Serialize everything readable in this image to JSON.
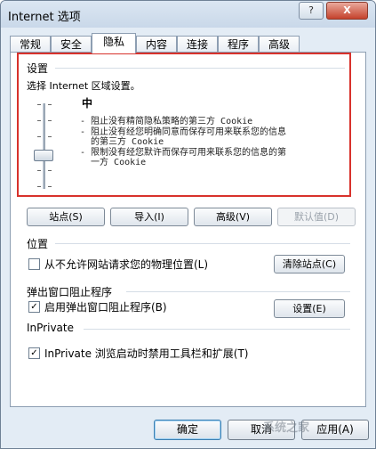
{
  "window": {
    "title": "Internet 选项",
    "help_label": "?",
    "close_label": "X"
  },
  "tabs": [
    {
      "label": "常规"
    },
    {
      "label": "安全"
    },
    {
      "label": "隐私"
    },
    {
      "label": "内容"
    },
    {
      "label": "连接"
    },
    {
      "label": "程序"
    },
    {
      "label": "高级"
    }
  ],
  "active_tab": "隐私",
  "settings": {
    "header": "设置",
    "instruction": "选择 Internet 区域设置。",
    "level": "中",
    "descriptions": [
      "- 阻止没有精简隐私策略的第三方 Cookie",
      "- 阻止没有经您明确同意而保存可用来联系您的信息\n  的第三方 Cookie",
      "- 限制没有经您默许而保存可用来联系您的信息的第\n  一方 Cookie"
    ],
    "buttons": {
      "sites": "站点(S)",
      "import": "导入(I)",
      "advanced": "高级(V)",
      "default": "默认值(D)"
    }
  },
  "location": {
    "header": "位置",
    "checkbox_label": "从不允许网站请求您的物理位置(L)",
    "checked": false,
    "clear_button": "清除站点(C)"
  },
  "popup": {
    "header": "弹出窗口阻止程序",
    "checkbox_label": "启用弹出窗口阻止程序(B)",
    "checked": true,
    "settings_button": "设置(E)"
  },
  "inprivate": {
    "header": "InPrivate",
    "checkbox_label": "InPrivate 浏览启动时禁用工具栏和扩展(T)",
    "checked": true
  },
  "footer": {
    "ok": "确定",
    "cancel": "取消",
    "apply": "应用(A)"
  },
  "watermark": "系统之家",
  "colors": {
    "highlight_box": "#d8322c",
    "window_bg": "#e3ecf5"
  }
}
